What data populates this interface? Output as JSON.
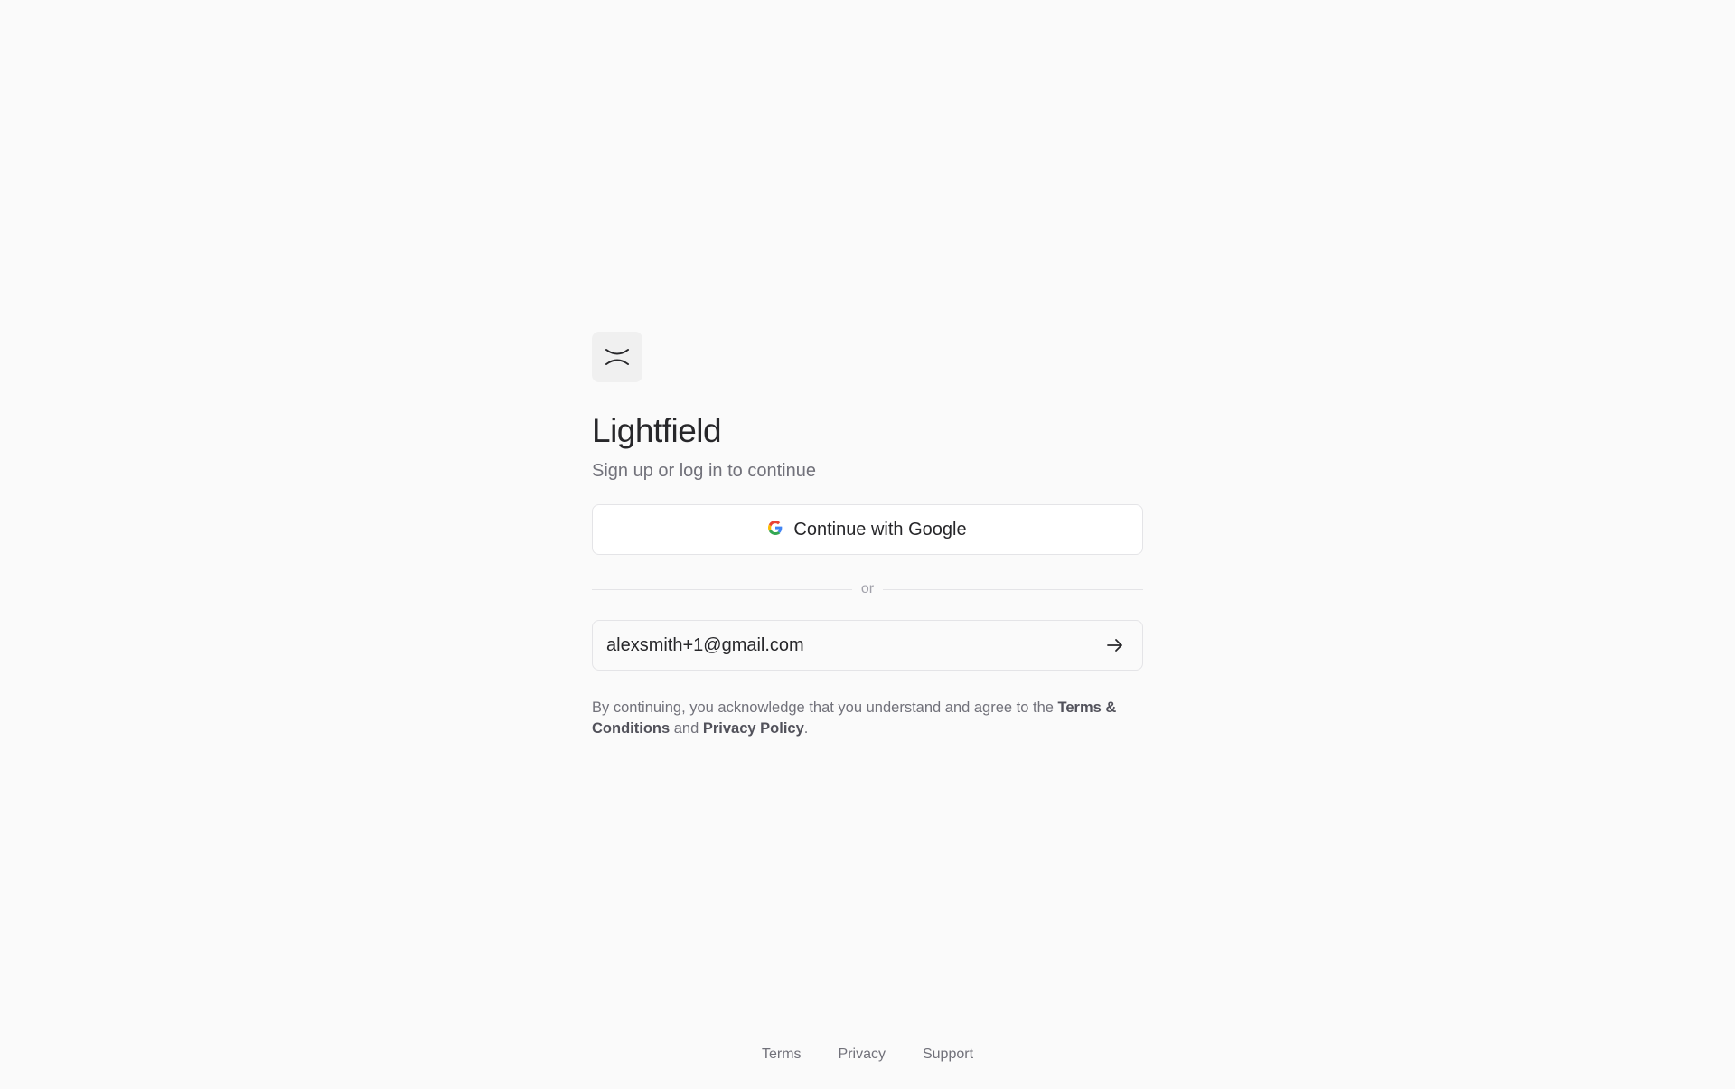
{
  "brand": {
    "logo_icon": "lightfield-logo-icon",
    "name": "Lightfield"
  },
  "auth": {
    "subtitle": "Sign up or log in to continue",
    "google_button_label": "Continue with Google",
    "google_icon": "google-g-icon",
    "divider_text": "or",
    "email_value": "alexsmith+1@gmail.com",
    "submit_icon": "arrow-right-icon"
  },
  "legal": {
    "prefix": "By continuing, you acknowledge that you understand and agree to the ",
    "terms_link": "Terms & Conditions",
    "middle": " and ",
    "privacy_link": "Privacy Policy",
    "suffix": "."
  },
  "footer": {
    "terms": "Terms",
    "privacy": "Privacy",
    "support": "Support"
  },
  "colors": {
    "background": "#fafafa",
    "border": "#e4e4e7",
    "text_primary": "#27272a",
    "text_muted": "#71717a"
  }
}
